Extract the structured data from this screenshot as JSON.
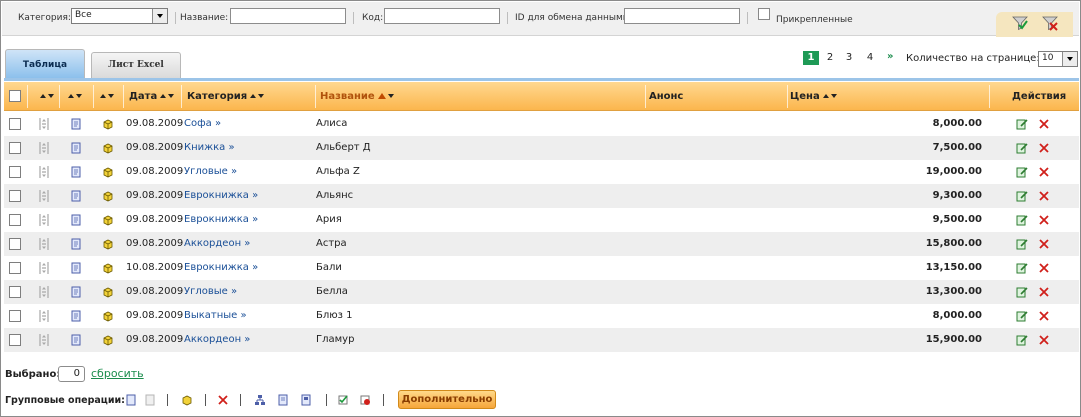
{
  "filters": {
    "category_label": "Категория:",
    "category_value": "Все",
    "name_label": "Название:",
    "name_value": "",
    "code_label": "Код:",
    "code_value": "",
    "exchange_id_label": "ID для обмена данными:",
    "exchange_id_value": "",
    "pinned_label": "Прикрепленные"
  },
  "tabs": {
    "table": "Таблица",
    "excel": "Лист Excel"
  },
  "pager": {
    "pages": [
      "1",
      "2",
      "3",
      "4"
    ],
    "current": "1",
    "next": "»",
    "per_page_label": "Количество на странице:",
    "per_page_value": "10"
  },
  "columns": {
    "date": "Дата",
    "category": "Категория",
    "name": "Название",
    "announce": "Анонс",
    "price": "Цена",
    "actions": "Действия"
  },
  "rows": [
    {
      "date": "09.08.2009",
      "category": "Софа »",
      "name": "Алиса",
      "price": "8,000.00"
    },
    {
      "date": "09.08.2009",
      "category": "Книжка »",
      "name": "Альберт Д",
      "price": "7,500.00"
    },
    {
      "date": "09.08.2009",
      "category": "Угловые »",
      "name": "Альфа Z",
      "price": "19,000.00"
    },
    {
      "date": "09.08.2009",
      "category": "Еврокнижка »",
      "name": "Альянс",
      "price": "9,300.00"
    },
    {
      "date": "09.08.2009",
      "category": "Еврокнижка »",
      "name": "Ария",
      "price": "9,500.00"
    },
    {
      "date": "09.08.2009",
      "category": "Аккордеон »",
      "name": "Астра",
      "price": "15,800.00"
    },
    {
      "date": "10.08.2009",
      "category": "Еврокнижка »",
      "name": "Бали",
      "price": "13,150.00"
    },
    {
      "date": "09.08.2009",
      "category": "Угловые »",
      "name": "Белла",
      "price": "13,300.00"
    },
    {
      "date": "09.08.2009",
      "category": "Выкатные »",
      "name": "Блюз 1",
      "price": "8,000.00"
    },
    {
      "date": "09.08.2009",
      "category": "Аккордеон »",
      "name": "Гламур",
      "price": "15,900.00"
    }
  ],
  "footer": {
    "selected_label": "Выбрано:",
    "selected_count": "0",
    "reset_label": "сбросить",
    "group_ops_label": "Групповые операции:",
    "extra_button": "Дополнительно"
  },
  "colors": {
    "header_orange": "#fbb64d",
    "tab_blue": "#8cc0ec",
    "link_blue": "#1a4f97",
    "pager_green": "#1e9a56",
    "delete_red": "#d0201b"
  }
}
